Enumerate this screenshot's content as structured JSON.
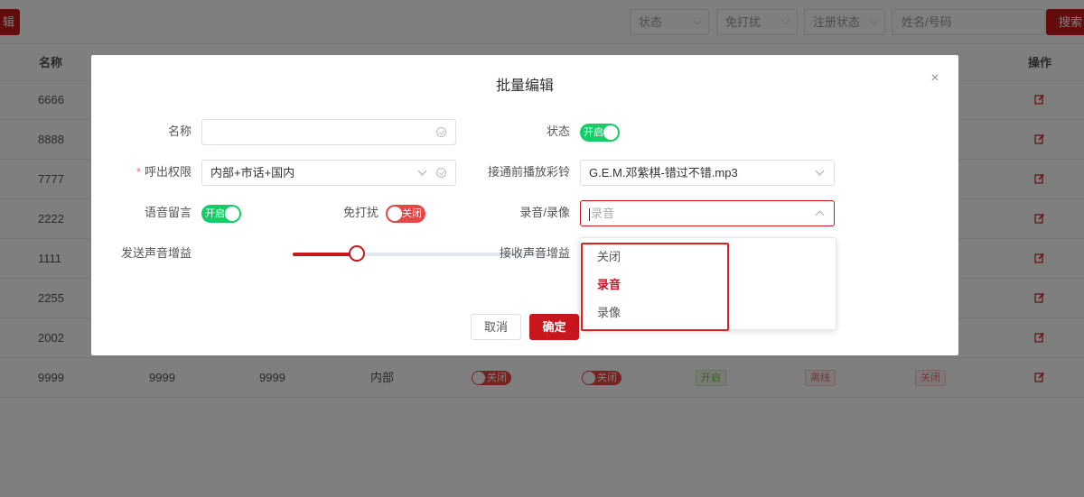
{
  "toolbar": {
    "edit_label": "辑",
    "filters": [
      {
        "label": "状态"
      },
      {
        "label": "免打扰"
      },
      {
        "label": "注册状态"
      }
    ],
    "search_placeholder": "姓名/号码",
    "search_button": "搜索"
  },
  "table": {
    "headers": {
      "name": "名称",
      "actions": "操作"
    },
    "rows": [
      {
        "name": "6666"
      },
      {
        "name": "8888"
      },
      {
        "name": "7777"
      },
      {
        "name": "2222"
      },
      {
        "name": "1111"
      },
      {
        "name": "2255"
      },
      {
        "name": "2002"
      },
      {
        "name": "9999",
        "col2": "9999",
        "col3": "9999",
        "col4": "内部",
        "switch1": "关闭",
        "switch2": "关闭",
        "tag1": "开启",
        "tag2": "离线",
        "tag3": "关闭"
      }
    ]
  },
  "dialog": {
    "title": "批量编辑",
    "close_icon": "close-icon",
    "fields": {
      "name_label": "名称",
      "name_value": "",
      "status_label": "状态",
      "status_switch": "开启",
      "call_label": "呼出权限",
      "call_value": "内部+市话+国内",
      "ringback_label": "接通前播放彩铃",
      "ringback_value": "G.E.M.邓紫棋-错过不错.mp3",
      "voicemail_label": "语音留言",
      "voicemail_switch": "开启",
      "dnd_label": "免打扰",
      "dnd_switch": "关闭",
      "record_label": "录音/录像",
      "record_placeholder": "录音",
      "send_gain_label": "发送声音增益",
      "send_gain_level": 0.25,
      "recv_gain_label": "接收声音增益"
    },
    "buttons": {
      "cancel": "取消",
      "confirm": "确定"
    },
    "dropdown_options": [
      "关闭",
      "录音",
      "录像"
    ],
    "dropdown_selected": "录音"
  },
  "colors": {
    "accent": "#c8161d",
    "switch_on": "#13ce66",
    "switch_off": "#e84545"
  }
}
